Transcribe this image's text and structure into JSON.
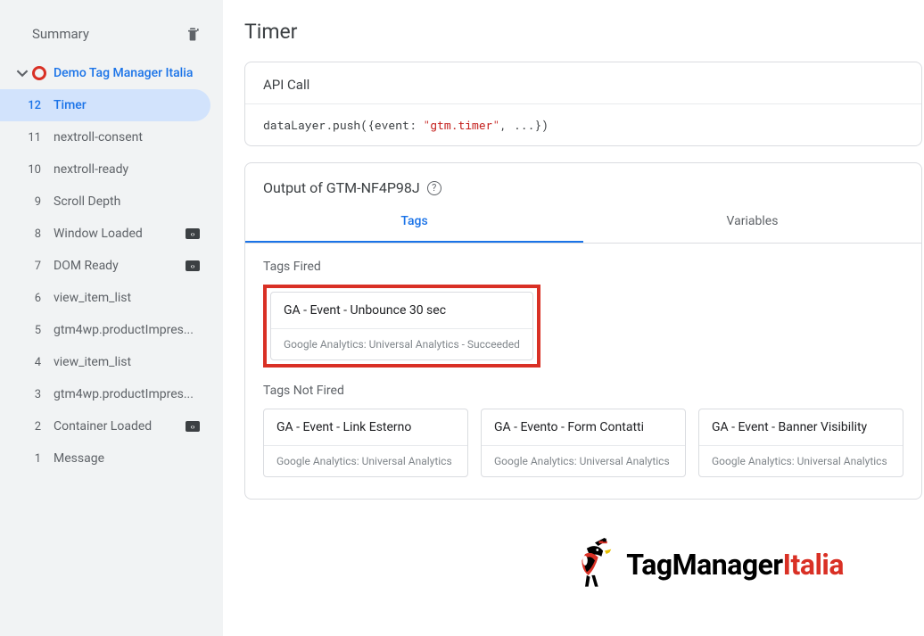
{
  "sidebar": {
    "summary_label": "Summary",
    "container_name": "Demo Tag Manager Italia",
    "events": [
      {
        "num": "12",
        "label": "Timer",
        "active": true,
        "code": false
      },
      {
        "num": "11",
        "label": "nextroll-consent",
        "active": false,
        "code": false
      },
      {
        "num": "10",
        "label": "nextroll-ready",
        "active": false,
        "code": false
      },
      {
        "num": "9",
        "label": "Scroll Depth",
        "active": false,
        "code": false
      },
      {
        "num": "8",
        "label": "Window Loaded",
        "active": false,
        "code": true
      },
      {
        "num": "7",
        "label": "DOM Ready",
        "active": false,
        "code": true
      },
      {
        "num": "6",
        "label": "view_item_list",
        "active": false,
        "code": false
      },
      {
        "num": "5",
        "label": "gtm4wp.productImpres...",
        "active": false,
        "code": false
      },
      {
        "num": "4",
        "label": "view_item_list",
        "active": false,
        "code": false
      },
      {
        "num": "3",
        "label": "gtm4wp.productImpres...",
        "active": false,
        "code": false
      },
      {
        "num": "2",
        "label": "Container Loaded",
        "active": false,
        "code": true
      },
      {
        "num": "1",
        "label": "Message",
        "active": false,
        "code": false
      }
    ]
  },
  "main": {
    "title": "Timer",
    "api_call_label": "API Call",
    "code_prefix": "dataLayer.push({event: ",
    "code_string": "\"gtm.timer\"",
    "code_suffix": ", ...})",
    "output_label": "Output of GTM-NF4P98J",
    "tabs": {
      "tags": "Tags",
      "variables": "Variables"
    },
    "fired_label": "Tags Fired",
    "not_fired_label": "Tags Not Fired",
    "fired": [
      {
        "title": "GA - Event - Unbounce 30 sec",
        "sub": "Google Analytics: Universal Analytics - Succeeded"
      }
    ],
    "not_fired": [
      {
        "title": "GA - Event - Link Esterno",
        "sub": "Google Analytics: Universal Analytics"
      },
      {
        "title": "GA - Evento - Form Contatti",
        "sub": "Google Analytics: Universal Analytics"
      },
      {
        "title": "GA - Event - Banner Visibility",
        "sub": "Google Analytics: Universal Analytics"
      }
    ]
  },
  "brand": {
    "text1": "TagManager",
    "text2": "Italia"
  }
}
